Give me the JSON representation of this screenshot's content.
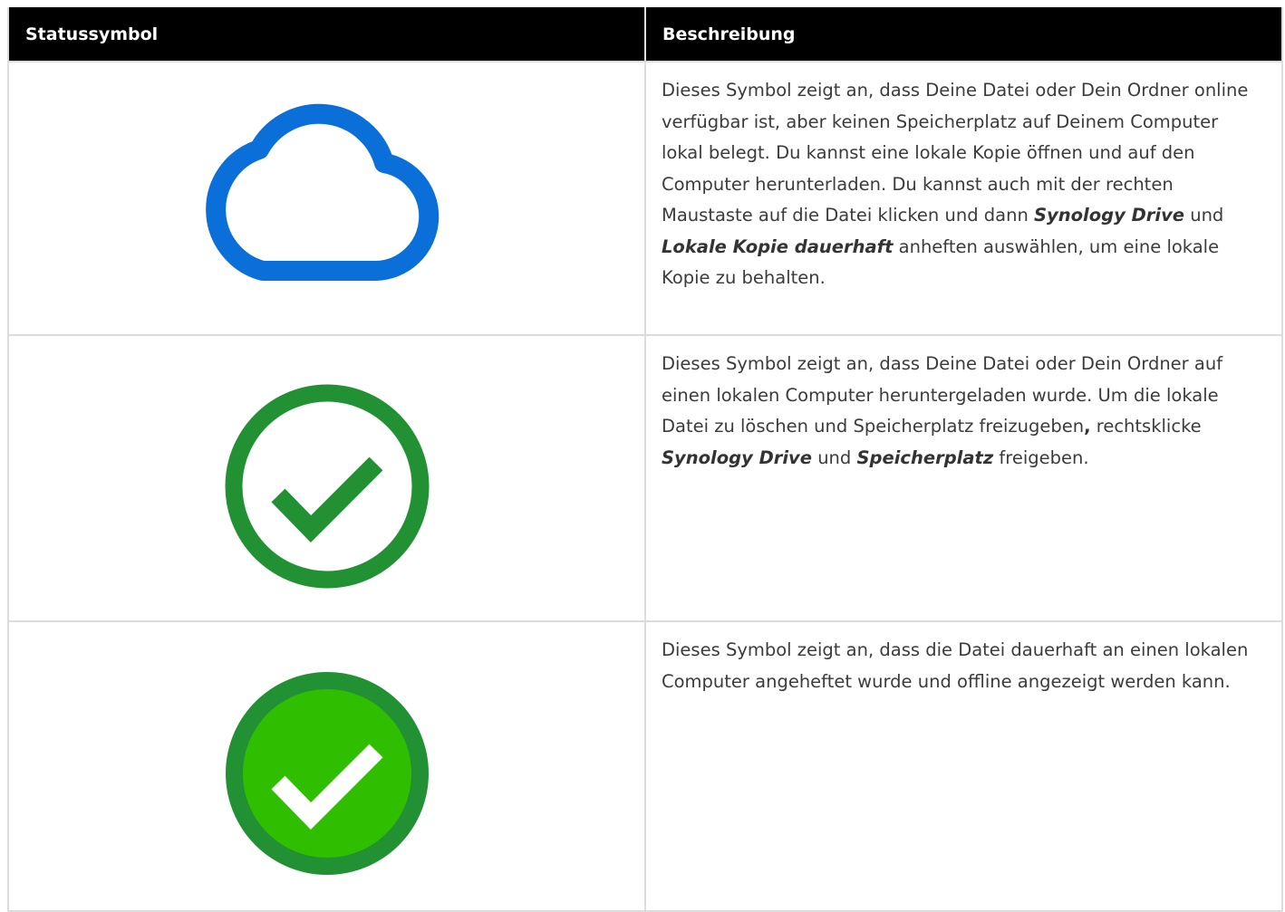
{
  "table": {
    "headers": {
      "status_icon": "Statussymbol",
      "description": "Beschreibung"
    },
    "rows": [
      {
        "icon": "cloud-outline-icon",
        "icon_color": "#0a6fd8",
        "text_parts": [
          "Dieses Symbol zeigt an, dass Deine Datei oder Dein Ordner online verfügbar ist, aber keinen Speicherplatz auf Deinem Computer lokal belegt. Du kannst eine lokale Kopie öffnen und auf den Computer herunterladen. Du kannst auch mit der rechten Maustaste auf die Datei klicken und dann ",
          "Synology Drive",
          " und ",
          "Lokale Kopie dauerhaft",
          " anheften auswählen, um eine lokale Kopie zu behalten."
        ]
      },
      {
        "icon": "check-circle-outline-icon",
        "icon_color": "#229133",
        "text_parts": [
          "Dieses Symbol zeigt an, dass Deine Datei oder Dein Ordner auf einen lokalen Computer heruntergeladen wurde. Um die lokale Datei zu löschen und Speicherplatz freizugeben",
          ",",
          " rechtsklicke ",
          "Synology Drive",
          " und ",
          "Speicherplatz",
          " freigeben."
        ]
      },
      {
        "icon": "check-circle-filled-icon",
        "icon_color": "#2fbf00",
        "icon_ring_color": "#229133",
        "text_parts": [
          "Dieses Symbol zeigt an, dass die Datei dauerhaft an einen lokalen Computer angeheftet wurde und offline angezeigt werden kann."
        ]
      }
    ]
  }
}
